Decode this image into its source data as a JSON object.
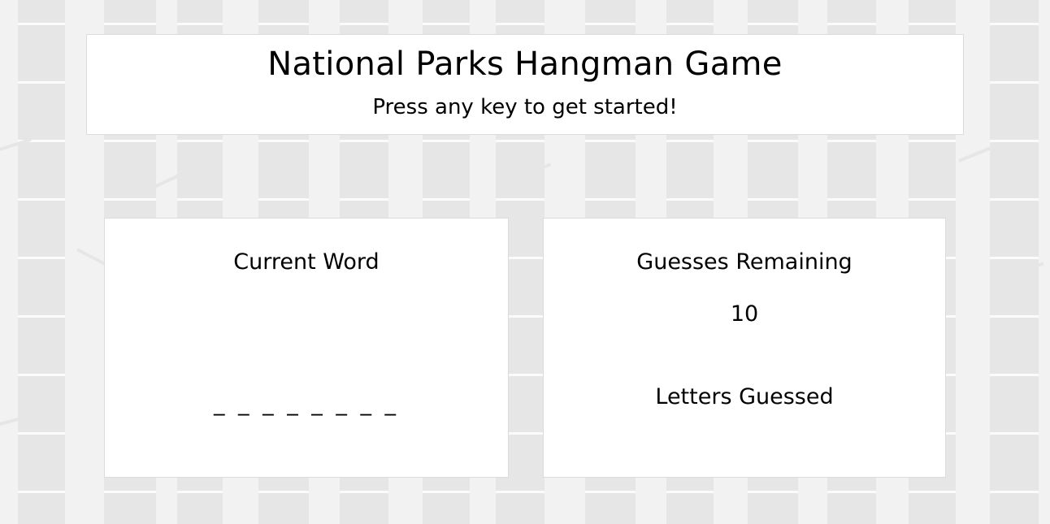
{
  "header": {
    "title": "National Parks Hangman Game",
    "subtitle": "Press any key to get started!"
  },
  "current_word": {
    "heading": "Current Word",
    "display": "_ _ _ _ _ _ _ _"
  },
  "stats": {
    "guesses_heading": "Guesses Remaining",
    "guesses_remaining": "10",
    "letters_heading": "Letters Guessed",
    "letters_guessed": ""
  },
  "colors": {
    "background": "#f2f2f2",
    "trunk": "#e6e6e6",
    "panel": "#ffffff",
    "text": "#000000"
  }
}
